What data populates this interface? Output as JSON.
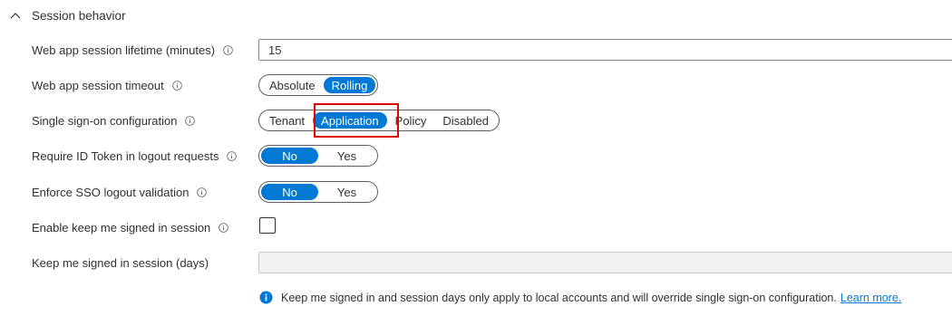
{
  "section": {
    "title": "Session behavior"
  },
  "fields": {
    "lifetime": {
      "label": "Web app session lifetime (minutes)",
      "value": "15"
    },
    "timeout": {
      "label": "Web app session timeout",
      "options": [
        "Absolute",
        "Rolling"
      ],
      "selected": "Rolling"
    },
    "sso": {
      "label": "Single sign-on configuration",
      "options": [
        "Tenant",
        "Application",
        "Policy",
        "Disabled"
      ],
      "selected": "Application"
    },
    "id_token": {
      "label": "Require ID Token in logout requests",
      "options": [
        "No",
        "Yes"
      ],
      "selected": "No"
    },
    "sso_logout": {
      "label": "Enforce SSO logout validation",
      "options": [
        "No",
        "Yes"
      ],
      "selected": "No"
    },
    "kmsi": {
      "label": "Enable keep me signed in session",
      "checked": false
    },
    "kmsi_days": {
      "label": "Keep me signed in session (days)",
      "value": ""
    }
  },
  "note": {
    "text": "Keep me signed in and session days only apply to local accounts and will override single sign-on configuration.",
    "link": "Learn more."
  },
  "colors": {
    "accent": "#0078d4",
    "highlight": "#e00000"
  }
}
